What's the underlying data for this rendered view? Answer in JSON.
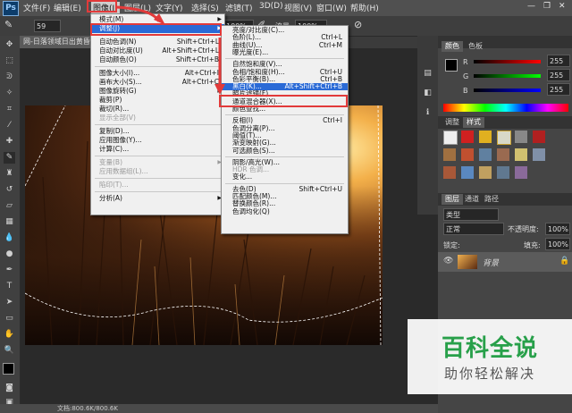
{
  "app": {
    "logo": "Ps"
  },
  "menubar": {
    "items": [
      "文件(F)",
      "编辑(E)",
      "图像(I)",
      "图层(L)",
      "文字(Y)",
      "选择(S)",
      "滤镜(T)",
      "3D(D)",
      "视图(V)",
      "窗口(W)",
      "帮助(H)"
    ]
  },
  "options": {
    "size": "59",
    "zoom": "100%",
    "flow_label": "流量:",
    "flow": "100%"
  },
  "document": {
    "tab_title": "网-日落领域日出黄昏...",
    "status": "文档:800.6K/800.6K"
  },
  "image_menu": {
    "items": [
      {
        "label": "模式(M)",
        "shortcut": "",
        "submenu": true
      },
      {
        "label": "调整(J)",
        "shortcut": "",
        "submenu": true,
        "highlight": true
      },
      {
        "sep": true
      },
      {
        "label": "自动色调(N)",
        "shortcut": "Shift+Ctrl+L"
      },
      {
        "label": "自动对比度(U)",
        "shortcut": "Alt+Shift+Ctrl+L"
      },
      {
        "label": "自动颜色(O)",
        "shortcut": "Shift+Ctrl+B"
      },
      {
        "sep": true
      },
      {
        "label": "图像大小(I)...",
        "shortcut": "Alt+Ctrl+I"
      },
      {
        "label": "画布大小(S)...",
        "shortcut": "Alt+Ctrl+C"
      },
      {
        "label": "图像旋转(G)",
        "shortcut": "",
        "submenu": true
      },
      {
        "label": "裁剪(P)",
        "shortcut": ""
      },
      {
        "label": "裁切(R)...",
        "shortcut": ""
      },
      {
        "label": "显示全部(V)",
        "shortcut": "",
        "disabled": true
      },
      {
        "sep": true
      },
      {
        "label": "复制(D)...",
        "shortcut": ""
      },
      {
        "label": "应用图像(Y)...",
        "shortcut": ""
      },
      {
        "label": "计算(C)...",
        "shortcut": ""
      },
      {
        "sep": true
      },
      {
        "label": "变量(B)",
        "shortcut": "",
        "submenu": true,
        "disabled": true
      },
      {
        "label": "应用数据组(L)...",
        "shortcut": "",
        "disabled": true
      },
      {
        "sep": true
      },
      {
        "label": "陷印(T)...",
        "shortcut": "",
        "disabled": true
      },
      {
        "sep": true
      },
      {
        "label": "分析(A)",
        "shortcut": "",
        "submenu": true
      }
    ]
  },
  "adjust_menu": {
    "items": [
      {
        "label": "亮度/对比度(C)...",
        "shortcut": ""
      },
      {
        "label": "色阶(L)...",
        "shortcut": "Ctrl+L"
      },
      {
        "label": "曲线(U)...",
        "shortcut": "Ctrl+M"
      },
      {
        "label": "曝光度(E)...",
        "shortcut": ""
      },
      {
        "sep": true
      },
      {
        "label": "自然饱和度(V)...",
        "shortcut": ""
      },
      {
        "label": "色相/饱和度(H)...",
        "shortcut": "Ctrl+U"
      },
      {
        "label": "色彩平衡(B)...",
        "shortcut": "Ctrl+B"
      },
      {
        "label": "黑白(K)...",
        "shortcut": "Alt+Shift+Ctrl+B",
        "highlight": true
      },
      {
        "label": "照片滤镜(F)...",
        "shortcut": ""
      },
      {
        "label": "通道混合器(X)...",
        "shortcut": ""
      },
      {
        "label": "颜色查找...",
        "shortcut": ""
      },
      {
        "sep": true
      },
      {
        "label": "反相(I)",
        "shortcut": "Ctrl+I"
      },
      {
        "label": "色调分离(P)...",
        "shortcut": ""
      },
      {
        "label": "阈值(T)...",
        "shortcut": ""
      },
      {
        "label": "渐变映射(G)...",
        "shortcut": ""
      },
      {
        "label": "可选颜色(S)...",
        "shortcut": ""
      },
      {
        "sep": true
      },
      {
        "label": "阴影/高光(W)...",
        "shortcut": ""
      },
      {
        "label": "HDR 色调...",
        "shortcut": "",
        "disabled": true
      },
      {
        "label": "变化...",
        "shortcut": ""
      },
      {
        "sep": true
      },
      {
        "label": "去色(D)",
        "shortcut": "Shift+Ctrl+U"
      },
      {
        "label": "匹配颜色(M)...",
        "shortcut": ""
      },
      {
        "label": "替换颜色(R)...",
        "shortcut": ""
      },
      {
        "label": "色调均化(Q)",
        "shortcut": ""
      }
    ]
  },
  "color_panel": {
    "tabs": [
      "颜色",
      "色板"
    ],
    "r": "",
    "g": "",
    "b": "",
    "r_value": "255",
    "g_value": "255",
    "b_value": "255"
  },
  "adjust_panel": {
    "tabs": [
      "调整",
      "样式"
    ]
  },
  "layers_panel": {
    "tabs": [
      "图层",
      "通道",
      "路径"
    ],
    "kind": "类型",
    "blend": "正常",
    "opacity_label": "不透明度:",
    "opacity": "100%",
    "lock_label": "锁定:",
    "fill_label": "填充:",
    "fill": "100%",
    "layer_name": "背景"
  },
  "watermark": {
    "title": "百科全说",
    "subtitle": "助你轻松解决"
  },
  "colors": {
    "accent": "#2a6ad6",
    "annotation": "#e23a3a",
    "watermark_green": "#28a04a"
  }
}
